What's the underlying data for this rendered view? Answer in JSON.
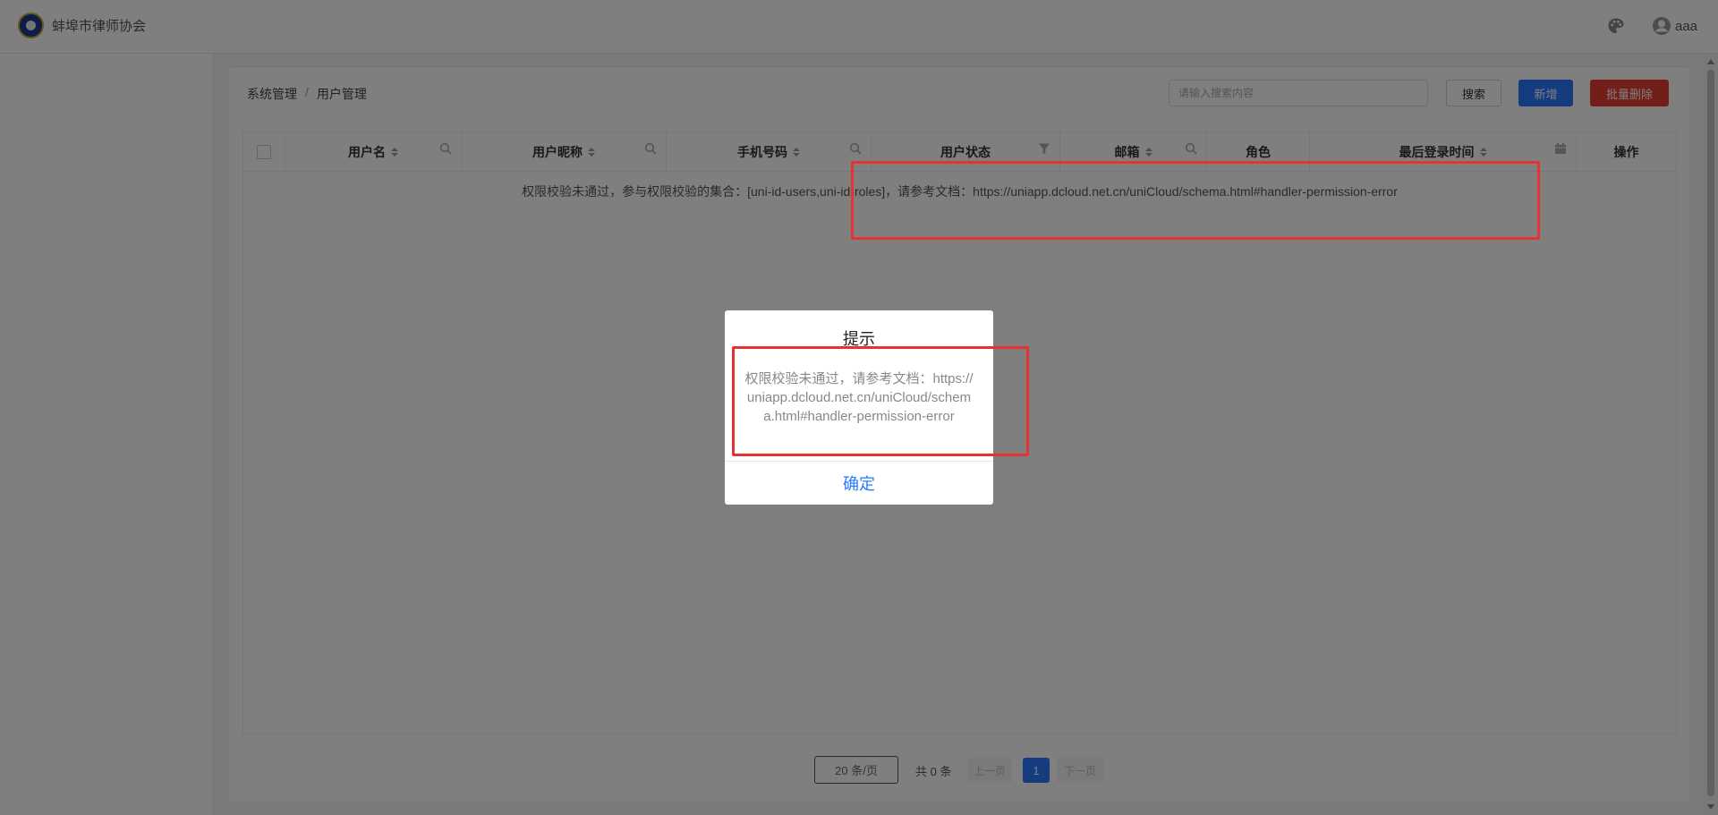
{
  "header": {
    "brand_name": "蚌埠市律师协会",
    "user_name": "aaa"
  },
  "breadcrumb": [
    "系统管理",
    "/",
    "用户管理"
  ],
  "toolbar": {
    "search_placeholder": "请输入搜索内容",
    "search_label": "搜索",
    "add_label": "新增",
    "batch_delete_label": "批量删除"
  },
  "table": {
    "columns": [
      {
        "label": "用户名",
        "sortable": true,
        "tool": "search"
      },
      {
        "label": "用户昵称",
        "sortable": true,
        "tool": "search"
      },
      {
        "label": "手机号码",
        "sortable": true,
        "tool": "search"
      },
      {
        "label": "用户状态",
        "sortable": false,
        "tool": "filter"
      },
      {
        "label": "邮箱",
        "sortable": true,
        "tool": "search"
      },
      {
        "label": "角色",
        "sortable": false,
        "tool": ""
      },
      {
        "label": "最后登录时间",
        "sortable": true,
        "tool": "calendar"
      },
      {
        "label": "操作",
        "sortable": false,
        "tool": ""
      }
    ],
    "empty_message": "权限校验未通过，参与权限校验的集合：[uni-id-users,uni-id-roles]，请参考文档：https://uniapp.dcloud.net.cn/uniCloud/schema.html#handler-permission-error"
  },
  "pagination": {
    "page_size": "20 条/页",
    "total": "共 0 条",
    "prev": "上一页",
    "current_page": "1",
    "next": "下一页"
  },
  "modal": {
    "title": "提示",
    "content": "权限校验未通过，请参考文档：https://uniapp.dcloud.net.cn/uniCloud/schema.html#handler-permission-error",
    "confirm_label": "确定"
  },
  "colors": {
    "primary": "#2979ff",
    "danger": "#e43d33",
    "annotation": "#e53232"
  }
}
